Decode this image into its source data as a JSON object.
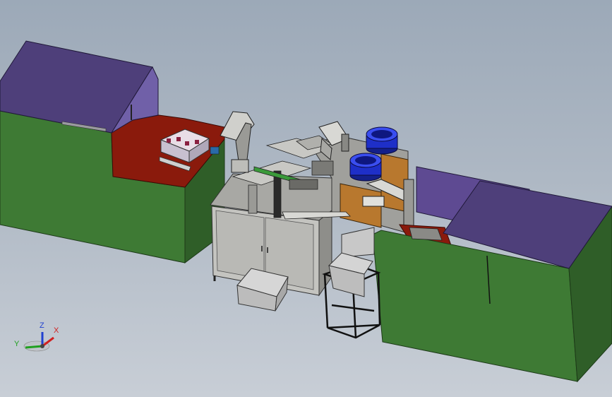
{
  "viewport": {
    "background_top": "#9ca9b8",
    "background_bottom": "#c8ced6"
  },
  "triad": {
    "x_label": "X",
    "y_label": "Y",
    "z_label": "Z",
    "x_color": "#d02020",
    "y_color": "#20a020",
    "z_color": "#2040d0"
  },
  "colors": {
    "enclosure_green": "#3e7a34",
    "enclosure_green_dark": "#2f5e28",
    "roof_purple": "#4e3f7a",
    "floor_red": "#8a1a0c",
    "frame_gray": "#b9b9b5",
    "bowl_blue": "#1e2fc8",
    "panel_orange": "#b8782e"
  },
  "parts": [
    "left-enclosure",
    "right-enclosure",
    "main-machine-cabinet",
    "vibratory-bowl-feeder",
    "parts-bin",
    "bin-stand"
  ]
}
